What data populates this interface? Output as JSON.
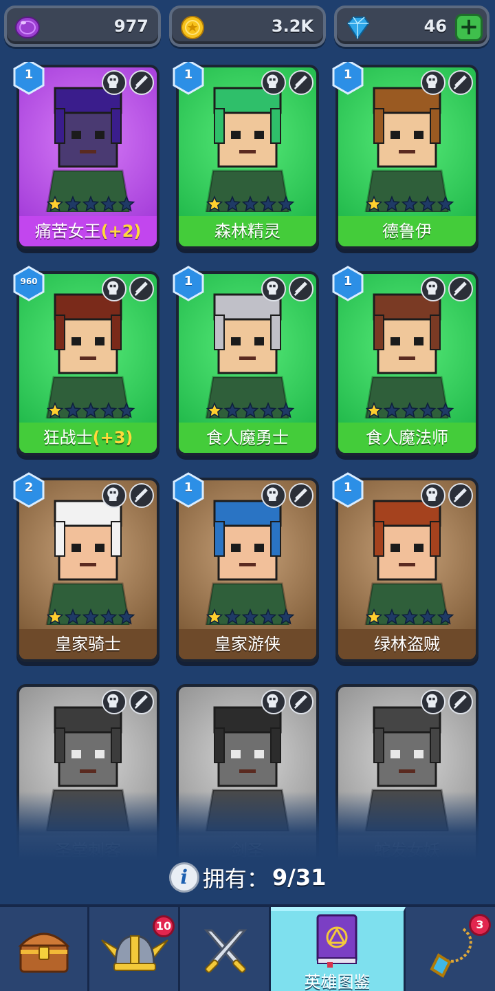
{
  "currency": {
    "orb": {
      "icon": "purple-orb-icon",
      "value": "977"
    },
    "gold": {
      "icon": "gold-coin-icon",
      "value": "3.2K"
    },
    "gems": {
      "icon": "diamond-icon",
      "value": "46",
      "plus": "+"
    }
  },
  "heroes": [
    {
      "level": "1",
      "name": "痛苦女王",
      "bonus": "(+2)",
      "stars": 1,
      "owned": true,
      "bg": "purple",
      "class_icon": "demon-skull-icon",
      "weapon_icon": "scepter-icon"
    },
    {
      "level": "1",
      "name": "森林精灵",
      "bonus": "",
      "stars": 1,
      "owned": true,
      "bg": "green",
      "class_icon": "elf-icon",
      "weapon_icon": "hammer-icon"
    },
    {
      "level": "1",
      "name": "德鲁伊",
      "bonus": "",
      "stars": 1,
      "owned": true,
      "bg": "green",
      "class_icon": "elf-icon",
      "weapon_icon": "sword-icon"
    },
    {
      "level": "960",
      "name": "狂战士",
      "bonus": "(+3)",
      "stars": 1,
      "owned": true,
      "bg": "green",
      "class_icon": "orc-icon",
      "weapon_icon": "sword-icon"
    },
    {
      "level": "1",
      "name": "食人魔勇士",
      "bonus": "",
      "stars": 1,
      "owned": true,
      "bg": "green",
      "class_icon": "orc-icon",
      "weapon_icon": "sword-icon"
    },
    {
      "level": "1",
      "name": "食人魔法师",
      "bonus": "",
      "stars": 1,
      "owned": true,
      "bg": "green",
      "class_icon": "orc-icon",
      "weapon_icon": "scepter-icon"
    },
    {
      "level": "2",
      "name": "皇家骑士",
      "bonus": "",
      "stars": 1,
      "owned": true,
      "bg": "brown",
      "class_icon": "helmet-icon",
      "weapon_icon": "sword-icon"
    },
    {
      "level": "1",
      "name": "皇家游侠",
      "bonus": "",
      "stars": 1,
      "owned": true,
      "bg": "brown",
      "class_icon": "helmet-icon",
      "weapon_icon": "bow-icon"
    },
    {
      "level": "1",
      "name": "绿林盗贼",
      "bonus": "",
      "stars": 1,
      "owned": true,
      "bg": "brown",
      "class_icon": "helmet-icon",
      "weapon_icon": "dagger-icon"
    },
    {
      "level": "",
      "name": "圣堂刺客",
      "bonus": "",
      "stars": 0,
      "owned": false,
      "bg": "gray",
      "class_icon": "angel-wings-icon",
      "weapon_icon": "dagger-icon"
    },
    {
      "level": "",
      "name": "剑圣",
      "bonus": "",
      "stars": 0,
      "owned": false,
      "bg": "gray",
      "class_icon": "orc-icon",
      "weapon_icon": "dagger-icon"
    },
    {
      "level": "",
      "name": "蛇发女妖",
      "bonus": "",
      "stars": 0,
      "owned": false,
      "bg": "gray",
      "class_icon": "demon-skull-icon",
      "weapon_icon": "bow-icon"
    }
  ],
  "owned_summary": {
    "label": "拥有：",
    "count": "9/31"
  },
  "nav": {
    "tabs": [
      {
        "icon": "treasure-chest-icon",
        "label": "",
        "badge": ""
      },
      {
        "icon": "viking-helmet-icon",
        "label": "",
        "badge": "10"
      },
      {
        "icon": "crossed-swords-icon",
        "label": "",
        "badge": ""
      },
      {
        "icon": "hero-book-icon",
        "label": "英雄图鉴",
        "badge": "",
        "active": true
      },
      {
        "icon": "amulet-icon",
        "label": "",
        "badge": "3"
      }
    ]
  },
  "colors": {
    "background": "#1f3f6e",
    "card_purple": "#b14de0",
    "card_green": "#32c85a",
    "card_brown": "#8a6a44",
    "card_gray": "#8a8a8a",
    "active_tab": "#7ee0ee",
    "badge": "#e2264f"
  }
}
